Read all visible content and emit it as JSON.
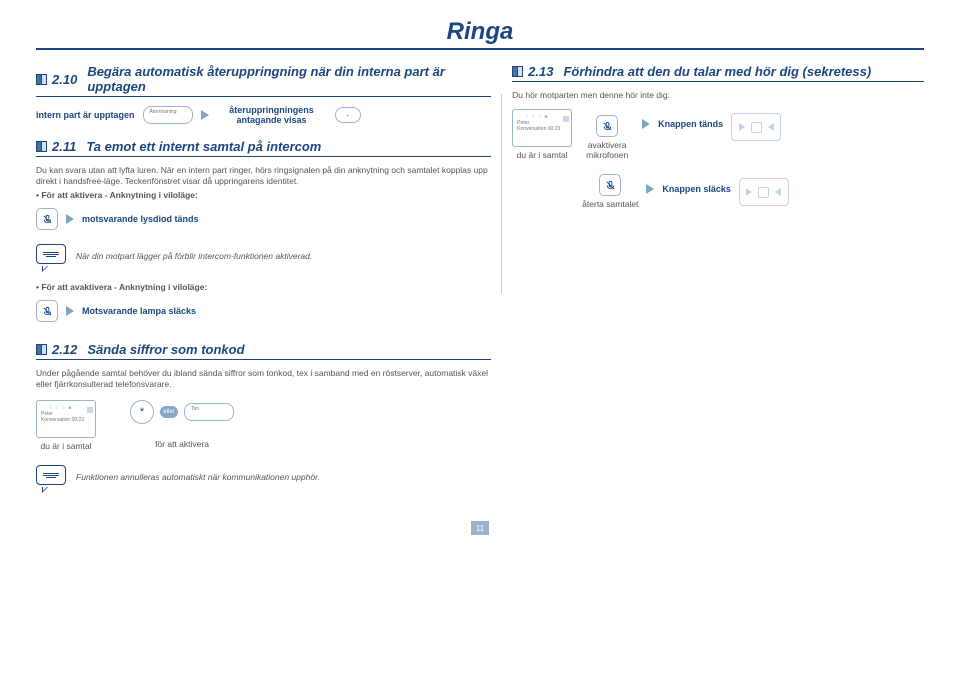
{
  "page_title": "Ringa",
  "page_number": "11",
  "sections": {
    "s210": {
      "num": "2.10",
      "title": "Begära automatisk återuppringning när din interna part är upptagen"
    },
    "s211": {
      "num": "2.11",
      "title": "Ta emot ett internt samtal på intercom"
    },
    "s212": {
      "num": "2.12",
      "title": "Sända siffror som tonkod"
    },
    "s213": {
      "num": "2.13",
      "title": "Förhindra att den du talar med hör dig (sekretess)"
    }
  },
  "labels": {
    "intern_part": "intern part är upptagen",
    "aterringning_btn": "Återrinaning",
    "ateruppringning_visas": "återuppringningens antagande visas",
    "du_i_samtal": "du är i samtal",
    "avaktivera_mikrofon": "avaktivera mikrofonen",
    "knappen_tands": "Knappen tänds",
    "knappen_slacks": "Knappen släcks",
    "aterta_samtalet": "återta samtalet",
    "motsvarande_tands": "motsvarande lysdiod tänds",
    "motsvarande_slacks": "Motsvarande lampa släcks",
    "for_att_aktivera": "för att aktivera",
    "eller": "eller",
    "ton": "Ton",
    "asterisk": "*",
    "peter": "Peter",
    "konversation": "Konversation 00:23"
  },
  "texts": {
    "s211_body": "Du kan svara utan att lyfta luren. När en intern part ringer, hörs ringsignalen på din anknytning och samtalet kopplas upp direkt i handsfree-läge. Teckenfönstret visar då uppringarens identitet.",
    "s211_bullet_activate": "För att aktivera - Anknytning i viloläge:",
    "s211_bullet_deactivate": "För att avaktivera - Anknytning i viloläge:",
    "s211_speech": "När din motpart lägger på förblir intercom-funktionen aktiverad.",
    "s212_body": "Under pågående samtal behöver du ibland sända siffror som tonkod, tex i samband med en röstserver, automatisk växel eller fjärrkonsulterad telefonsvarare.",
    "s212_speech": "Funktionen annulleras automatiskt när kommunikationen upphör.",
    "s213_intro": "Du hör motparten men denne hör inte dig:"
  }
}
